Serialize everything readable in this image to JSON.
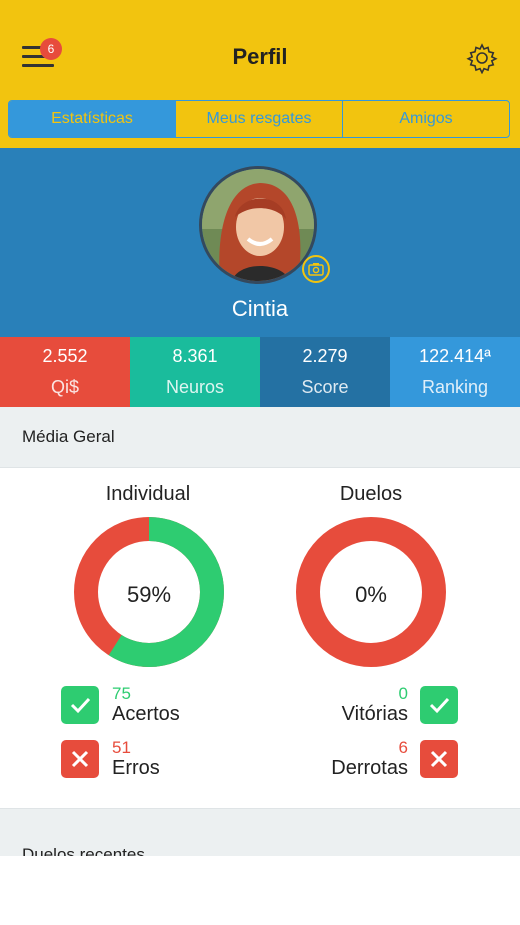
{
  "header": {
    "title": "Perfil",
    "notification_count": "6",
    "tabs": [
      {
        "label": "Estatísticas",
        "active": true
      },
      {
        "label": "Meus resgates",
        "active": false
      },
      {
        "label": "Amigos",
        "active": false
      }
    ]
  },
  "profile": {
    "name": "Cintia"
  },
  "stats": [
    {
      "value": "2.552",
      "label": "Qi$",
      "color": "#E74C3C"
    },
    {
      "value": "8.361",
      "label": "Neuros",
      "color": "#1ABC9C"
    },
    {
      "value": "2.279",
      "label": "Score",
      "color": "#2471A3"
    },
    {
      "value": "122.414ª",
      "label": "Ranking",
      "color": "#3498DB"
    }
  ],
  "media_geral": {
    "section_title": "Média Geral",
    "individual": {
      "title": "Individual",
      "percent_label": "59%",
      "correct_fraction": 0.59,
      "acertos_count": "75",
      "acertos_label": "Acertos",
      "erros_count": "51",
      "erros_label": "Erros"
    },
    "duelos": {
      "title": "Duelos",
      "percent_label": "0%",
      "win_fraction": 0,
      "vitorias_count": "0",
      "vitorias_label": "Vitórias",
      "derrotas_count": "6",
      "derrotas_label": "Derrotas"
    }
  },
  "recent": {
    "section_title": "Duelos recentes"
  },
  "colors": {
    "yellow": "#F2C40F",
    "blue": "#3498DB",
    "green": "#2ECC71",
    "red": "#E74C3C"
  }
}
